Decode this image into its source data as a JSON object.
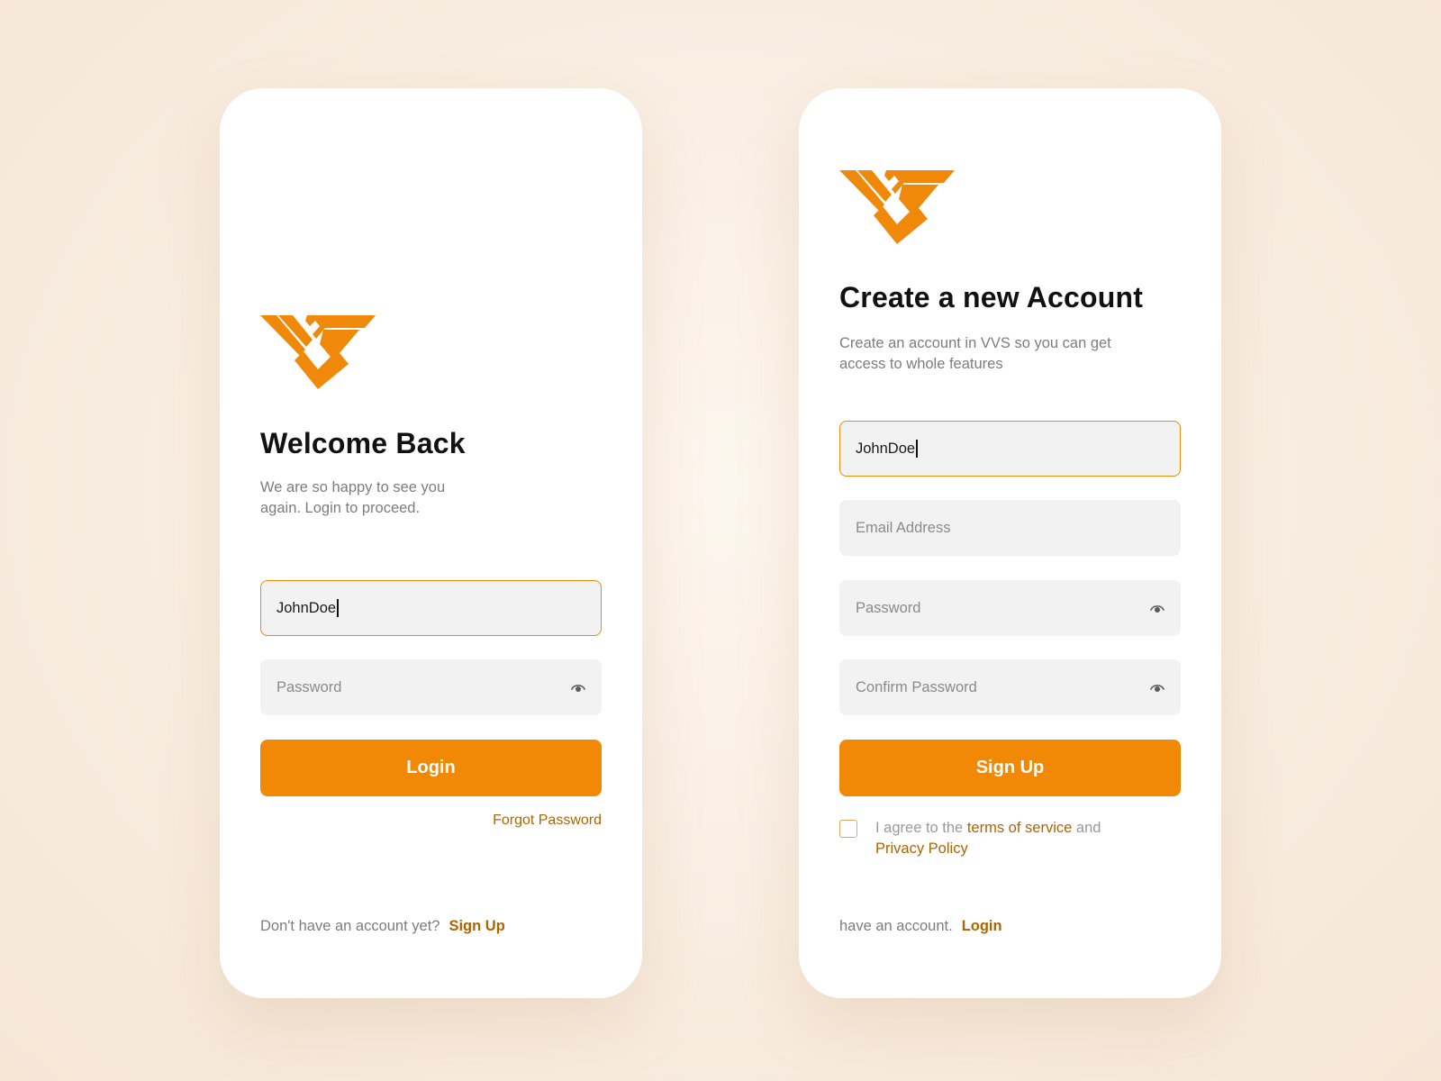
{
  "colors": {
    "accent": "#f18806",
    "link": "#b06400",
    "background": "#f8ece0",
    "card": "#ffffff"
  },
  "login": {
    "logo_icon": "vvs-logo",
    "title": "Welcome Back",
    "subtitle": "We are so happy to see you again. Login to proceed.",
    "username_value": "JohnDoe",
    "password_placeholder": "Password",
    "password_icon": "eye-icon",
    "button_label": "Login",
    "forgot_label": "Forgot Password",
    "footer_text": "Don't have an account yet?",
    "footer_link": "Sign Up"
  },
  "signup": {
    "logo_icon": "vvs-logo",
    "title": "Create a new Account",
    "subtitle": "Create an account in VVS so you can get access to whole features",
    "username_value": "JohnDoe",
    "email_placeholder": "Email Address",
    "password_placeholder": "Password",
    "confirm_placeholder": "Confirm Password",
    "password_icon": "eye-icon",
    "button_label": "Sign Up",
    "agree_prefix": "I agree to the",
    "terms_link": "terms of service",
    "agree_and": "and",
    "privacy_link": "Privacy Policy",
    "footer_text": "have an account.",
    "footer_link": "Login"
  }
}
